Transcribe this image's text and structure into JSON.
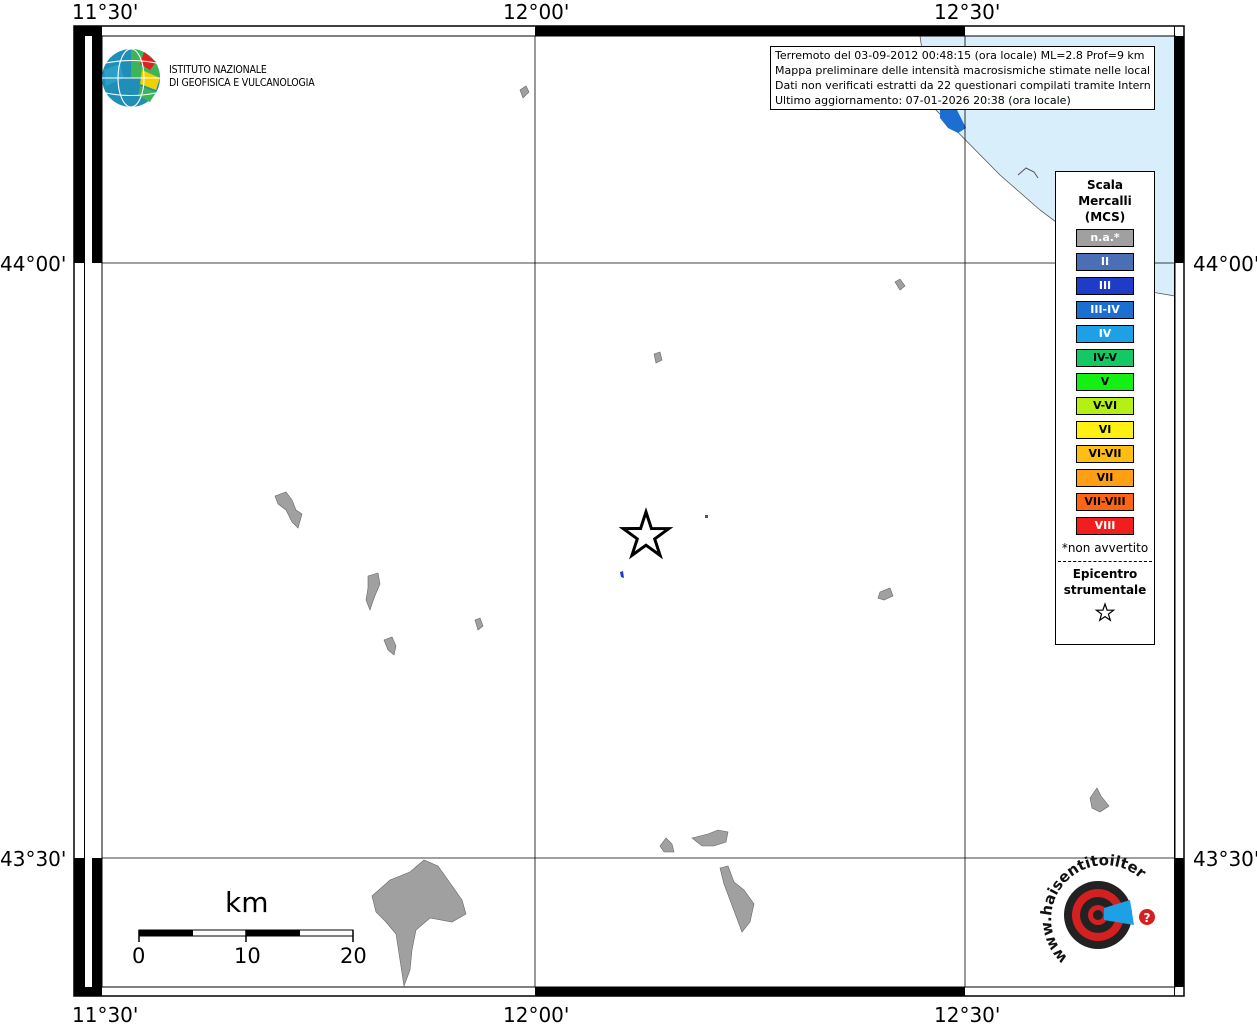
{
  "axes": {
    "top_labels": [
      "11°30'",
      "12°00'",
      "12°30'"
    ],
    "bottom_labels": [
      "11°30'",
      "12°00'",
      "12°30'"
    ],
    "left_labels": [
      "44°00'",
      "43°30'"
    ],
    "right_labels": [
      "44°00'",
      "43°30'"
    ]
  },
  "info": {
    "line1": "Terremoto del 03-09-2012 00:48:15 (ora locale) ML=2.8 Prof=9 km",
    "line2": "Mappa preliminare delle intensità macrosismiche stimate nelle località",
    "line3": "Dati non verificati estratti da 22 questionari compilati tramite Internet.",
    "line4": "Ultimo aggiornamento: 07-01-2026 20:38 (ora locale)"
  },
  "logo": {
    "line1": "ISTITUTO NAZIONALE",
    "line2": "DI GEOFISICA E VULCANOLOGIA"
  },
  "legend": {
    "title_line1": "Scala",
    "title_line2": "Mercalli",
    "title_line3": "(MCS)",
    "items": [
      {
        "label": "n.a.*",
        "color": "#a0a0a0",
        "text_color": "#ffffff"
      },
      {
        "label": "II",
        "color": "#4a6fb5",
        "text_color": "#ffffff"
      },
      {
        "label": "III",
        "color": "#1e3cc8",
        "text_color": "#ffffff"
      },
      {
        "label": "III-IV",
        "color": "#1c6fd0",
        "text_color": "#ffffff"
      },
      {
        "label": "IV",
        "color": "#1ea0e6",
        "text_color": "#ffffff"
      },
      {
        "label": "IV-V",
        "color": "#14c864",
        "text_color": "#000000"
      },
      {
        "label": "V",
        "color": "#14f014",
        "text_color": "#000000"
      },
      {
        "label": "V-VI",
        "color": "#b4f014",
        "text_color": "#000000"
      },
      {
        "label": "VI",
        "color": "#fff014",
        "text_color": "#000000"
      },
      {
        "label": "VI-VII",
        "color": "#ffbe14",
        "text_color": "#000000"
      },
      {
        "label": "VII",
        "color": "#ffa014",
        "text_color": "#000000"
      },
      {
        "label": "VII-VIII",
        "color": "#ff6414",
        "text_color": "#000000"
      },
      {
        "label": "VIII",
        "color": "#f01e1e",
        "text_color": "#ffffff"
      }
    ],
    "note": "*non avvertito",
    "epicenter_line1": "Epicentro",
    "epicenter_line2": "strumentale"
  },
  "scalebar": {
    "unit": "km",
    "labels": [
      "0",
      "10",
      "20"
    ]
  },
  "watermark": {
    "text": "www.haisentitoilterremoto.it"
  },
  "colors": {
    "sea": "#d8eefa",
    "town": "#a0a0a0",
    "intensity_III": "#1e3cc8",
    "intensity_III_IV": "#1c6fd0"
  }
}
